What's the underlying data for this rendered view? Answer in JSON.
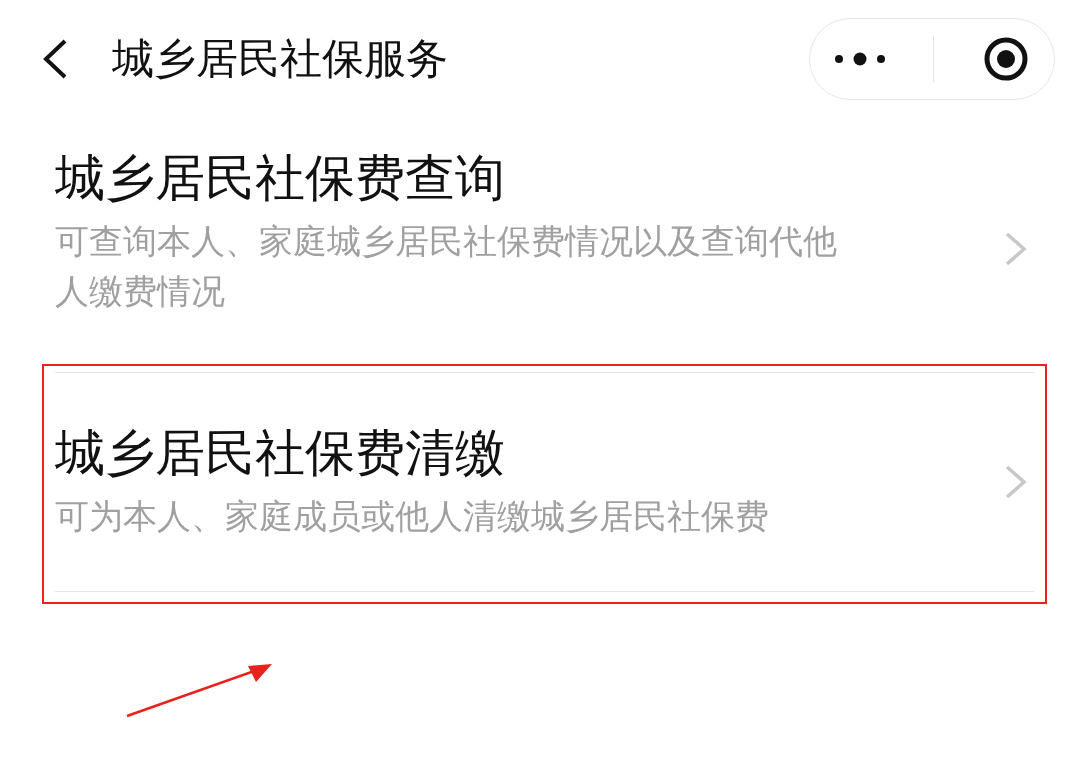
{
  "nav_bar": {
    "title": "城乡居民社保服务"
  },
  "items": [
    {
      "title": "城乡居民社保费查询",
      "description": "可查询本人、家庭城乡居民社保费情况以及查询代他人缴费情况",
      "highlighted": false
    },
    {
      "title": "城乡居民社保费清缴",
      "description": "可为本人、家庭成员或他人清缴城乡居民社保费",
      "highlighted": true
    }
  ],
  "annotations": [
    {
      "kind": "arrow"
    }
  ]
}
